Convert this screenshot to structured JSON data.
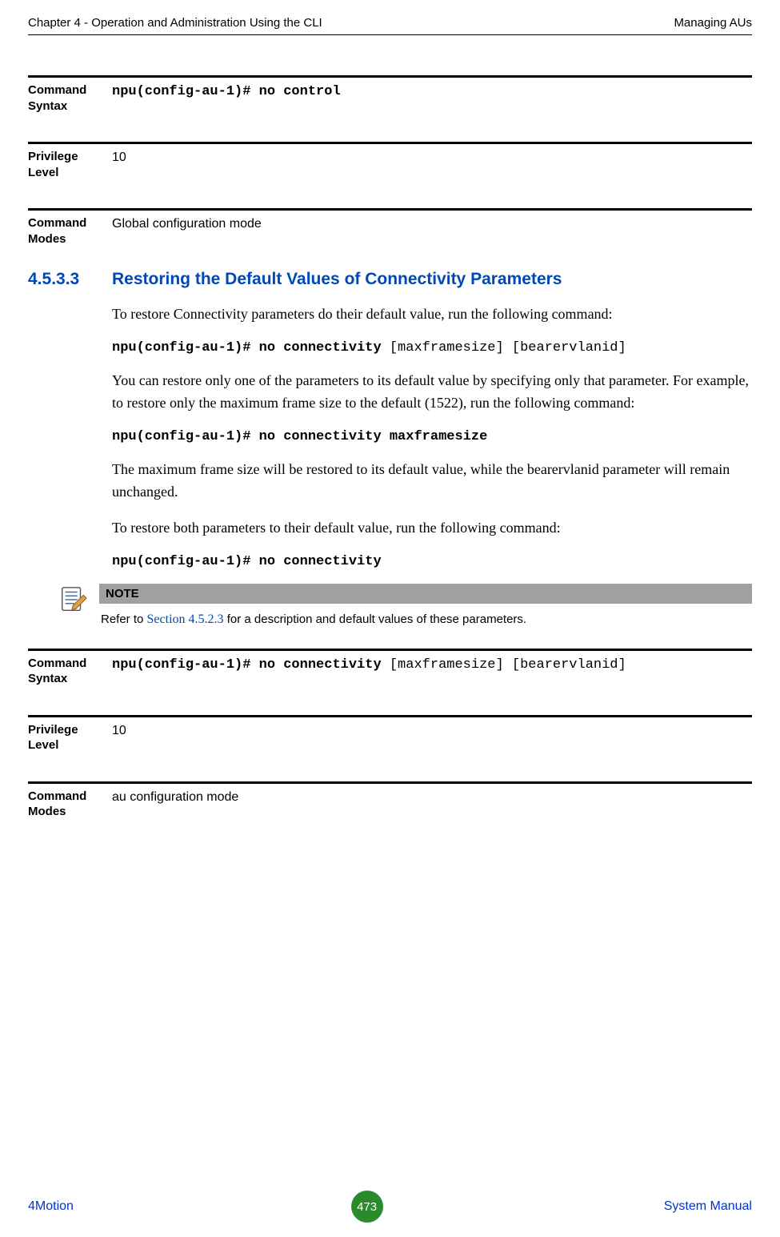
{
  "header": {
    "left": "Chapter 4 - Operation and Administration Using the CLI",
    "right": "Managing AUs"
  },
  "blocks1": {
    "syntax_label": "Command Syntax",
    "syntax_value_bold": "npu(config-au-1)# no control",
    "priv_label": "Privilege Level",
    "priv_value": "10",
    "modes_label": "Command Modes",
    "modes_value": "Global configuration mode"
  },
  "section": {
    "num": "4.5.3.3",
    "title": "Restoring the Default Values of Connectivity Parameters"
  },
  "body": {
    "p1": "To restore Connectivity parameters do their default value, run the following command:",
    "cmd1_bold": "npu(config-au-1)# no connectivity ",
    "cmd1_norm": "[maxframesize] [bearervlanid]",
    "p2": "You can restore only one of the parameters to its default value by specifying only that parameter. For example, to restore only the maximum frame size to the default (1522), run the following command:",
    "cmd2": "npu(config-au-1)# no connectivity maxframesize",
    "p3": "The maximum frame size will be restored to its default value, while the bearervlanid parameter will remain unchanged.",
    "p4": "To restore both parameters to their default value, run the following command:",
    "cmd3": "npu(config-au-1)# no connectivity"
  },
  "note": {
    "head": "NOTE",
    "text_pre": "Refer to ",
    "link": "Section 4.5.2.3",
    "text_post": " for a description and default values of these parameters."
  },
  "blocks2": {
    "syntax_label": "Command Syntax",
    "syntax_bold": "npu(config-au-1)# no connectivity ",
    "syntax_norm": "[maxframesize] [bearervlanid]",
    "priv_label": "Privilege Level",
    "priv_value": "10",
    "modes_label": "Command Modes",
    "modes_value": "au configuration mode"
  },
  "footer": {
    "left": "4Motion",
    "page": "473",
    "right": " System Manual"
  }
}
